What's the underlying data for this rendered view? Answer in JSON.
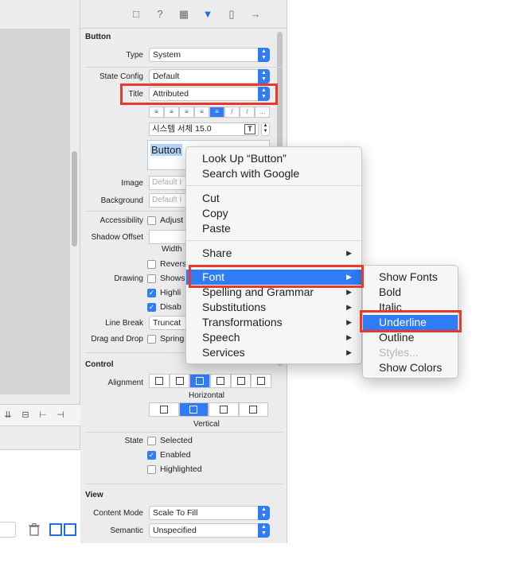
{
  "inspector": {
    "button_section": "Button",
    "type_label": "Type",
    "type_value": "System",
    "state_config_label": "State Config",
    "state_config_value": "Default",
    "title_label": "Title",
    "title_value": "Attributed",
    "font_value": "시스템 서체 15.0",
    "title_text": "Button",
    "image_label": "Image",
    "image_placeholder": "Default I",
    "background_label": "Background",
    "background_placeholder": "Default I",
    "accessibility_label": "Accessibility",
    "accessibility_check": "Adjust",
    "shadow_offset_label": "Shadow Offset",
    "width_label": "Width",
    "reverses_label": "Revers",
    "drawing_label": "Drawing",
    "shows_label": "Shows",
    "highlighted_label": "Highli",
    "disabled_label": "Disab",
    "line_break_label": "Line Break",
    "line_break_value": "Truncat",
    "drag_drop_label": "Drag and Drop",
    "spring_label": "Spring",
    "control_section": "Control",
    "alignment_label": "Alignment",
    "horizontal_label": "Horizontal",
    "vertical_label": "Vertical",
    "state_label": "State",
    "selected_label": "Selected",
    "enabled_label": "Enabled",
    "highlighted_state_label": "Highlighted",
    "view_section": "View",
    "content_mode_label": "Content Mode",
    "content_mode_value": "Scale To Fill",
    "semantic_label": "Semantic",
    "semantic_value": "Unspecified"
  },
  "context_menu": {
    "look_up": "Look Up “Button”",
    "search_google": "Search with Google",
    "cut": "Cut",
    "copy": "Copy",
    "paste": "Paste",
    "share": "Share",
    "font": "Font",
    "spelling": "Spelling and Grammar",
    "substitutions": "Substitutions",
    "transformations": "Transformations",
    "speech": "Speech",
    "services": "Services"
  },
  "font_submenu": {
    "show_fonts": "Show Fonts",
    "bold": "Bold",
    "italic": "Italic",
    "underline": "Underline",
    "outline": "Outline",
    "styles": "Styles...",
    "show_colors": "Show Colors"
  },
  "colors": {
    "accent": "#2f7cf6",
    "highlight_box": "#e8392c"
  }
}
